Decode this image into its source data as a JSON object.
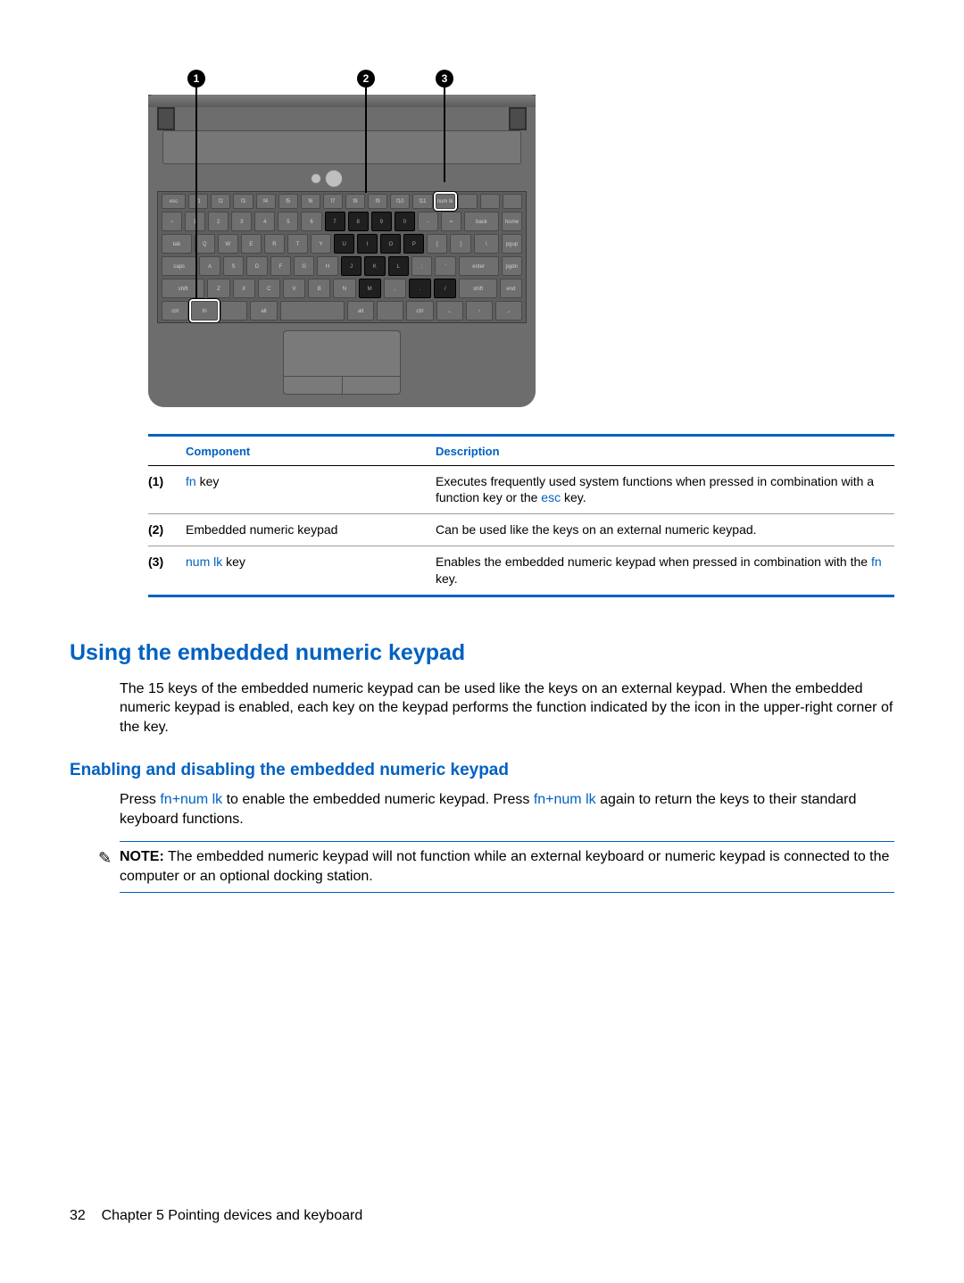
{
  "callouts": {
    "1": "1",
    "2": "2",
    "3": "3"
  },
  "table": {
    "head": {
      "component": "Component",
      "description": "Description"
    },
    "rows": [
      {
        "idx": "(1)",
        "key": "fn",
        "afterKey": " key",
        "desc_a": "Executes frequently used system functions when pressed in combination with a function key or the ",
        "desc_key": "esc",
        "desc_b": " key."
      },
      {
        "idx": "(2)",
        "plain": "Embedded numeric keypad",
        "desc_plain": "Can be used like the keys on an external numeric keypad."
      },
      {
        "idx": "(3)",
        "key": "num lk",
        "afterKey": " key",
        "desc_a": "Enables the embedded numeric keypad when pressed in combination with the ",
        "desc_key": "fn",
        "desc_b": " key."
      }
    ]
  },
  "heading1": "Using the embedded numeric keypad",
  "para1": "The 15 keys of the embedded numeric keypad can be used like the keys on an external keypad. When the embedded numeric keypad is enabled, each key on the keypad performs the function indicated by the icon in the upper-right corner of the key.",
  "heading2": "Enabling and disabling the embedded numeric keypad",
  "para2_a": "Press ",
  "para2_k1": "fn+num lk",
  "para2_b": " to enable the embedded numeric keypad. Press ",
  "para2_k2": "fn+num lk",
  "para2_c": " again to return the keys to their standard keyboard functions.",
  "note": {
    "label": "NOTE:",
    "text": "The embedded numeric keypad will not function while an external keyboard or numeric keypad is connected to the computer or an optional docking station."
  },
  "footer": {
    "page": "32",
    "chapter": "Chapter 5   Pointing devices and keyboard"
  }
}
